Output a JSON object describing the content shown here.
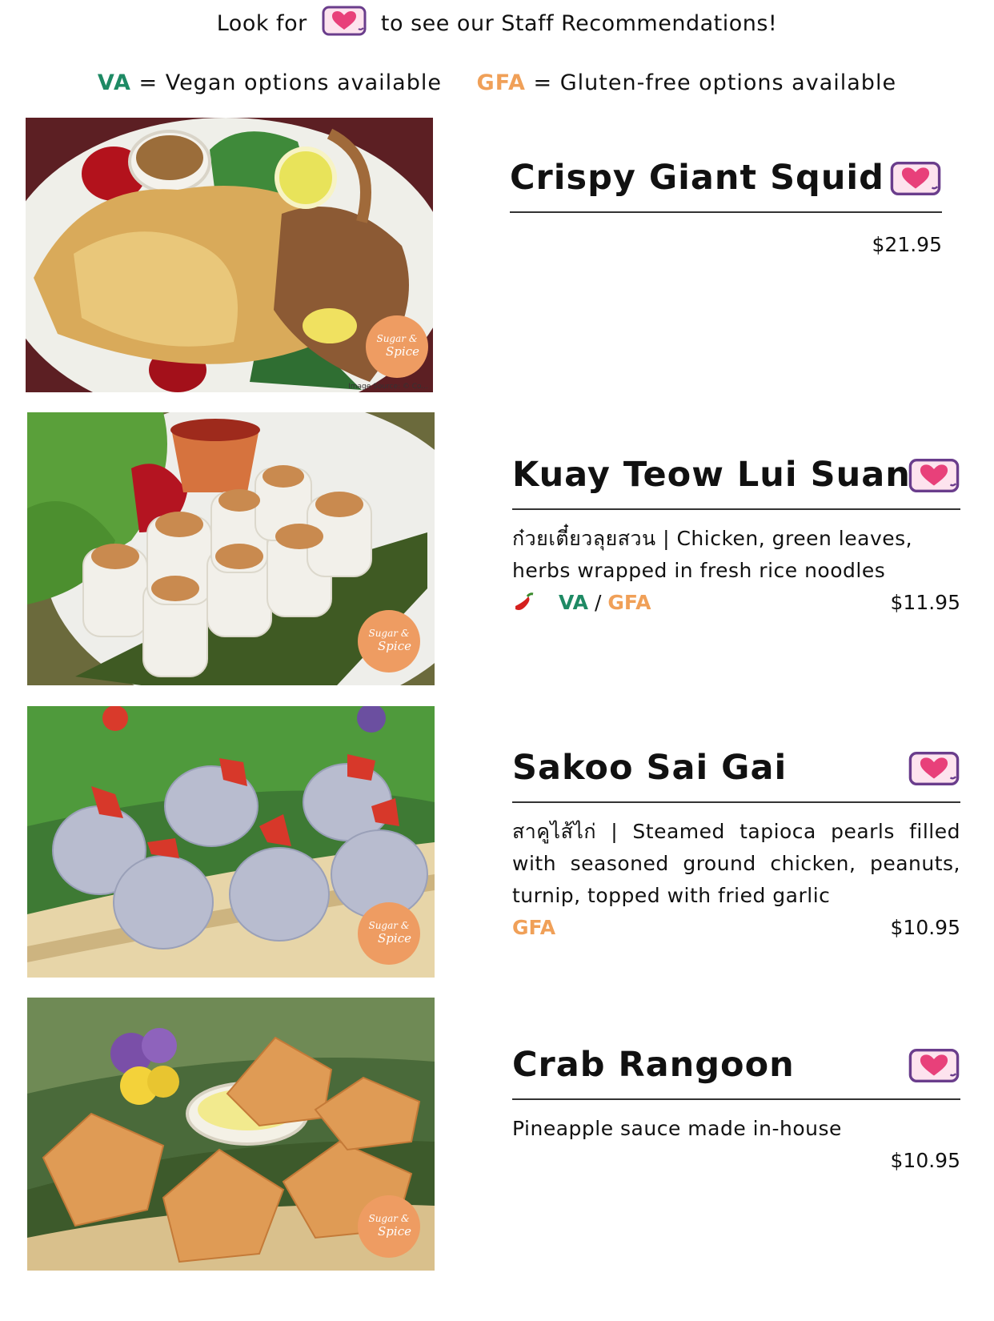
{
  "header": {
    "line_before": "Look for",
    "line_after": "to see our Staff Recommendations!",
    "legend_va_code": "VA",
    "legend_va_text": "= Vegan options available",
    "legend_gfa_code": "GFA",
    "legend_gfa_text": "= Gluten-free options available"
  },
  "colors": {
    "va": "#1e8a64",
    "gfa": "#f0a058",
    "heart": "#e8407a",
    "badge_border": "#6a3d8c",
    "logo": "#ee9c62"
  },
  "logo": {
    "line1": "Sugar &",
    "line2": "Spice"
  },
  "photo_credit": "Image Source: © Co...",
  "items": [
    {
      "name": "Crispy Giant Squid",
      "thai": "",
      "description": "",
      "tags": [],
      "price": "$21.95",
      "staff_pick": true
    },
    {
      "name": "Kuay Teow Lui Suan",
      "thai": "ก๋วยเตี๋ยวลุยสวน",
      "description": "ก๋วยเตี๋ยวลุยสวน | Chicken, green leaves, herbs wrapped in fresh rice noodles",
      "spicy": true,
      "tag_va": "VA",
      "tag_sep": "/",
      "tag_gfa": "GFA",
      "price": "$11.95",
      "staff_pick": true
    },
    {
      "name": "Sakoo Sai Gai",
      "description": "สาคูไส้ไก่ | Steamed tapioca pearls filled with seasoned ground chicken, peanuts, turnip, topped with fried garlic",
      "tag_gfa": "GFA",
      "price": "$10.95",
      "staff_pick": true
    },
    {
      "name": "Crab Rangoon",
      "description": "Pineapple sauce made in-house",
      "price": "$10.95",
      "staff_pick": true
    }
  ]
}
